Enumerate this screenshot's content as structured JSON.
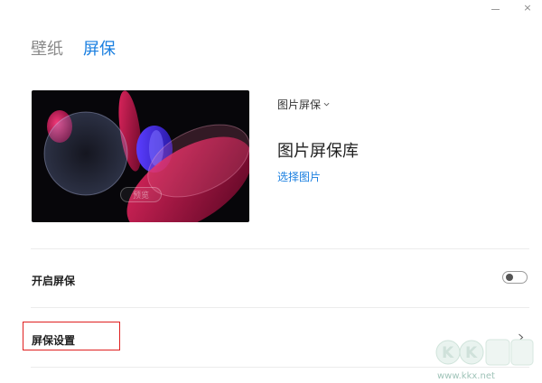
{
  "window": {
    "minimize_glyph": "—",
    "close_glyph": "×"
  },
  "tabs": [
    {
      "label": "壁纸",
      "active": false
    },
    {
      "label": "屏保",
      "active": true
    }
  ],
  "preview": {
    "button_label": "预览"
  },
  "screensaver": {
    "type_label": "图片屏保",
    "library_title": "图片屏保库",
    "select_link": "选择图片"
  },
  "settings": {
    "enable_label": "开启屏保",
    "enable_on": false,
    "settings_label": "屏保设置"
  },
  "watermark": {
    "url": "www.kkx.net",
    "logo_text": "KK下载"
  },
  "colors": {
    "accent": "#1a7fe0",
    "highlight": "#e02020",
    "tab_inactive": "#8a8a8a"
  },
  "icons": {
    "dropdown": "chevron-down-icon",
    "settings_arrow": "chevron-right-icon"
  }
}
